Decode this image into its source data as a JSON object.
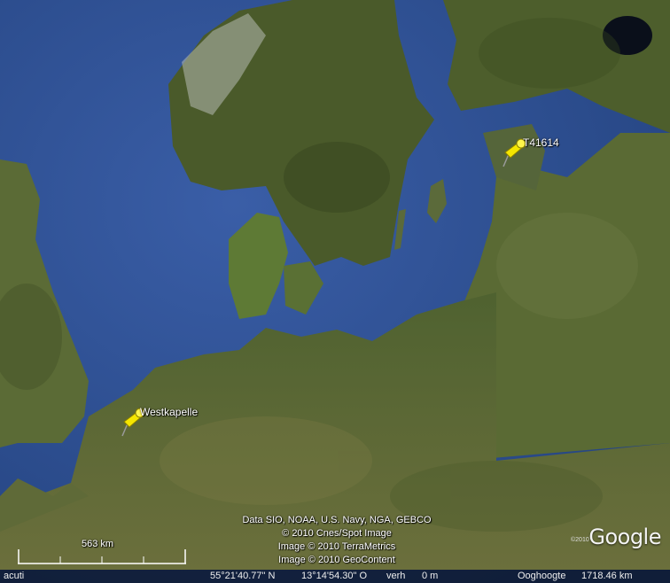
{
  "placemarks": [
    {
      "name": "T41614",
      "color": "#f5e600"
    },
    {
      "name": "Westkapelle",
      "color": "#f5e600"
    }
  ],
  "attribution": [
    "Data SIO, NOAA, U.S. Navy, NGA, GEBCO",
    "© 2010 Cnes/Spot Image",
    "Image © 2010 TerraMetrics",
    "Image © 2010 GeoContent"
  ],
  "scale": {
    "label": "563 km"
  },
  "logo": {
    "text": "Google",
    "copyright": "©2010"
  },
  "status": {
    "left_text": "acuti",
    "latitude": "55°21'40.77\" N",
    "longitude": "13°14'54.30\" O",
    "stream_label": "verh",
    "elevation": "0 m",
    "eye_alt_label": "Ooghoogte",
    "eye_alt_value": "1718.46 km"
  },
  "colors": {
    "sea": "#33539a",
    "deep_sea": "#23417c",
    "land": "#5e6b34",
    "forest": "#3f5024",
    "snow": "#d9ddd6"
  }
}
